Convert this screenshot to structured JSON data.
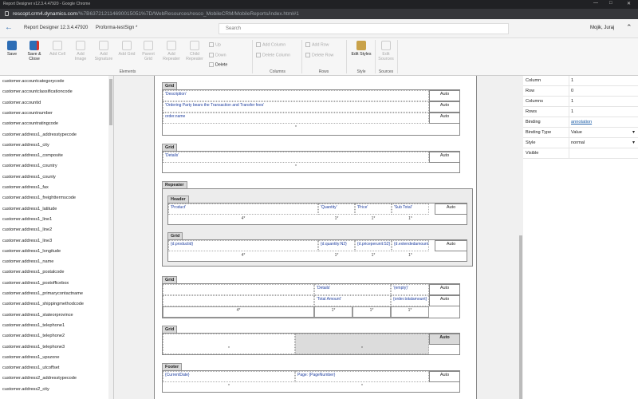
{
  "browser": {
    "window_title": "Report Designer v12.3.4.47920 - Google Chrome",
    "url_host": "rescopt.crm4.dynamics.com",
    "url_path": "/%7B637212114690015051%7D/WebResources/resco_MobileCRM/MobileReports/index.html#1"
  },
  "app": {
    "title": "Report Designer 12.3.4.47920",
    "tab": "Proforma-testSign *",
    "search_placeholder": "Search",
    "user": "Mojik, Juraj"
  },
  "ribbon": {
    "save": "Save",
    "save_close_1": "Save &",
    "save_close_2": "Close",
    "add_cell": "Add Cell",
    "add_image_1": "Add",
    "add_image_2": "Image",
    "add_signature_1": "Add",
    "add_signature_2": "Signature",
    "add_grid": "Add Grid",
    "parent_grid_1": "Parent",
    "parent_grid_2": "Grid",
    "add_repeater_1": "Add",
    "add_repeater_2": "Repeater",
    "child_repeater_1": "Child",
    "child_repeater_2": "Repeater",
    "up": "Up",
    "down": "Down",
    "delete": "Delete",
    "add_column": "Add Column",
    "delete_column": "Delete Column",
    "add_row": "Add Row",
    "delete_row": "Delete Row",
    "edit_styles": "Edit Styles",
    "edit_sources_1": "Edit",
    "edit_sources_2": "Sources",
    "groups": {
      "elements": "Elements",
      "columns": "Columns",
      "rows": "Rows",
      "style": "Style",
      "sources": "Sources"
    }
  },
  "fields": [
    "customer.accountcategorycode",
    "customer.accountclassificationcode",
    "customer.accountid",
    "customer.accountnumber",
    "customer.accountratingcode",
    "customer.address1_addresstypecode",
    "customer.address1_city",
    "customer.address1_composite",
    "customer.address1_country",
    "customer.address1_county",
    "customer.address1_fax",
    "customer.address1_freighttermscode",
    "customer.address1_latitude",
    "customer.address1_line1",
    "customer.address1_line2",
    "customer.address1_line3",
    "customer.address1_longitude",
    "customer.address1_name",
    "customer.address1_postalcode",
    "customer.address1_postofficebox",
    "customer.address1_primarycontactname",
    "customer.address1_shippingmethodcode",
    "customer.address1_stateorprovince",
    "customer.address1_telephone1",
    "customer.address1_telephone2",
    "customer.address1_telephone3",
    "customer.address1_upszone",
    "customer.address1_utcoffset",
    "customer.address2_addresstypecode",
    "customer.address2_city"
  ],
  "report": {
    "grid1": {
      "label": "Grid",
      "rows": [
        "'Description'",
        "'Ordering Party bears the Transaction and Transfer fees'",
        "order.name"
      ],
      "auto": "Auto",
      "footer": "*"
    },
    "grid2": {
      "label": "Grid",
      "cell": "'Details'",
      "auto": "Auto",
      "footer": "*"
    },
    "repeater": {
      "label": "Repeater",
      "header": {
        "label": "Header",
        "cells": [
          "'Product'",
          "'Quantity'",
          "'Price'",
          "'Sub Total'"
        ],
        "auto": "Auto",
        "fracs": [
          "4*",
          "1*",
          "1*",
          "1*"
        ]
      },
      "grid": {
        "label": "Grid",
        "cells": [
          "{d.productid}",
          "{d.quantity:N2}",
          "{d.priceperunit:S2}",
          "{d.extendedamount}"
        ],
        "auto": "Auto",
        "fracs": [
          "4*",
          "1*",
          "1*",
          "1*"
        ]
      }
    },
    "grid3": {
      "label": "Grid",
      "row1": [
        "'Details'",
        "'(empty)'"
      ],
      "row2": [
        "'Total Amount'",
        "{order.totalamount}"
      ],
      "auto": "Auto",
      "fracs": [
        "4*",
        "1*",
        "1*",
        "1*"
      ]
    },
    "grid4": {
      "label": "Grid",
      "auto": "Auto",
      "fracs": [
        "*",
        "*"
      ]
    },
    "footer": {
      "label": "Footer",
      "cells": [
        "{CurrentDate}",
        "Page: {PageNumber}"
      ],
      "auto": "Auto",
      "fracs": [
        "*",
        "*"
      ]
    }
  },
  "properties": [
    {
      "key": "Column",
      "value": "1"
    },
    {
      "key": "Row",
      "value": "0"
    },
    {
      "key": "Columns",
      "value": "1"
    },
    {
      "key": "Rows",
      "value": "1"
    },
    {
      "key": "Binding",
      "value": "annotation"
    },
    {
      "key": "Binding Type",
      "value": "Value"
    },
    {
      "key": "Style",
      "value": "normal"
    },
    {
      "key": "Visible",
      "value": ""
    }
  ],
  "colors": {
    "accent": "#1f5fa8",
    "binding_text": "#1f3fa0"
  }
}
